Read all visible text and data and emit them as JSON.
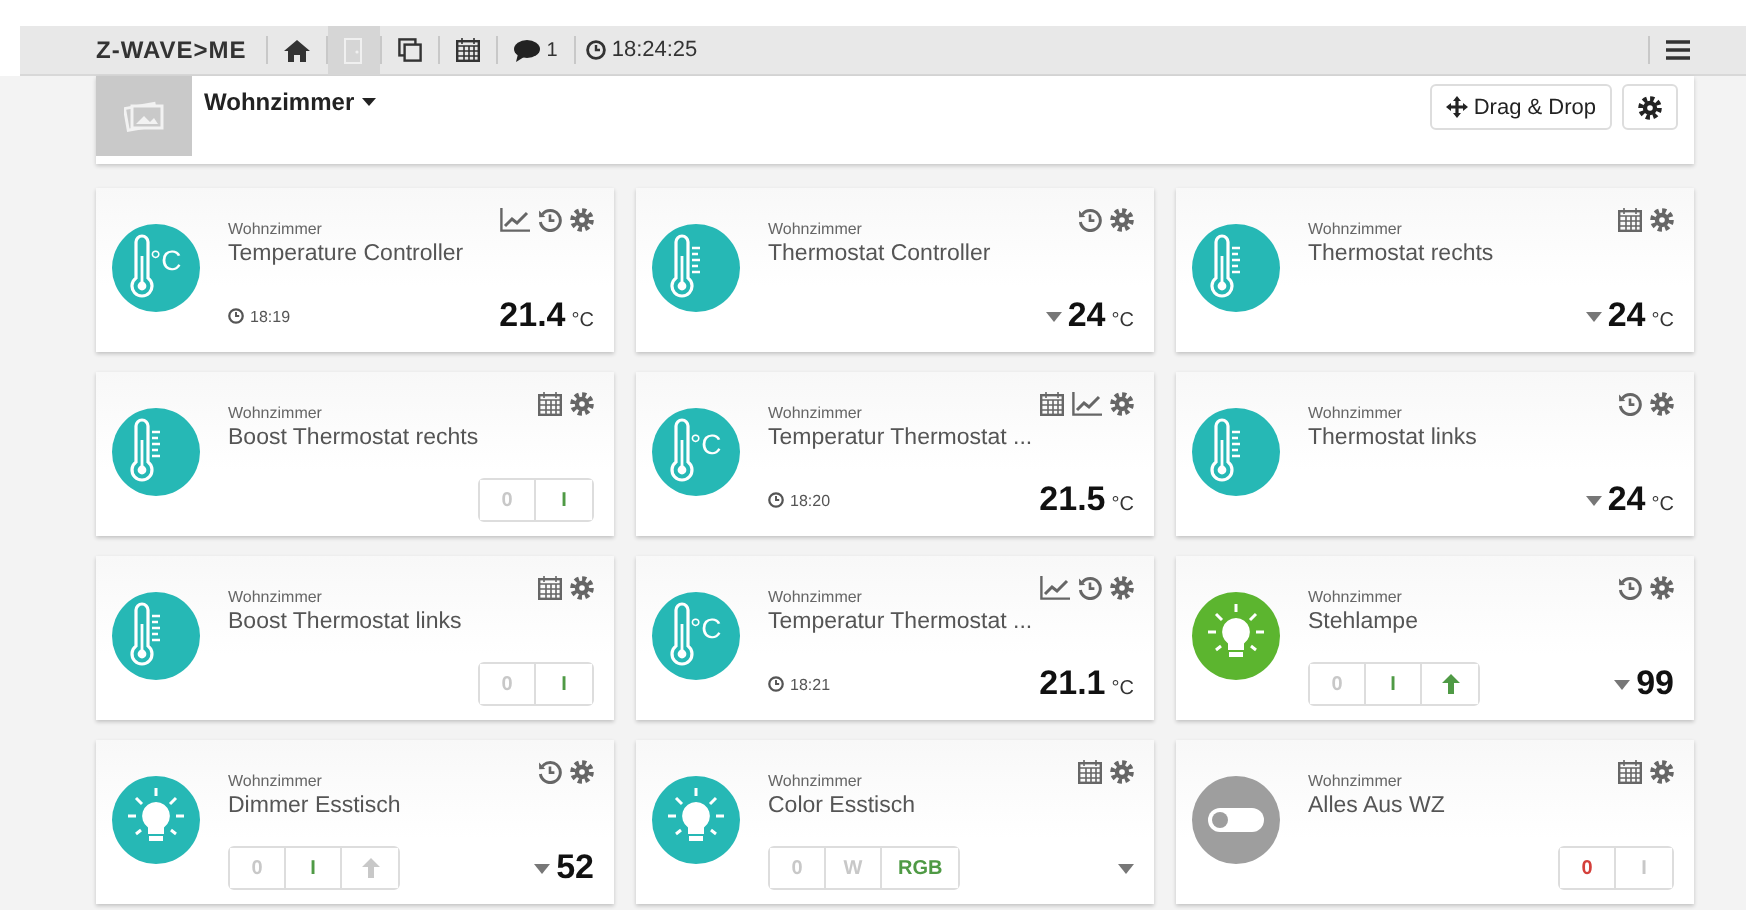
{
  "navbar": {
    "logo": "Z-WAVE>ME",
    "items": [
      {
        "kind": "home",
        "selected": false
      },
      {
        "kind": "room",
        "selected": true
      },
      {
        "kind": "elements",
        "selected": false
      },
      {
        "kind": "calendar",
        "selected": false
      },
      {
        "kind": "messages",
        "selected": false,
        "count": "1"
      }
    ],
    "clock": "18:24:25"
  },
  "room": {
    "name": "Wohnzimmer",
    "drag_button": "Drag & Drop"
  },
  "cards": [
    {
      "room": "Wohnzimmer",
      "name": "Temperature Controller",
      "symbol": {
        "kind": "thermometer",
        "label": "°C",
        "color": "#26b8b5"
      },
      "actions": [
        {
          "kind": "chart"
        },
        {
          "kind": "history"
        }
      ],
      "kind": "sensor",
      "time": "18:19",
      "value": "21.4",
      "unit": "°C"
    },
    {
      "room": "Wohnzimmer",
      "name": "Thermostat Controller",
      "symbol": {
        "kind": "thermometer",
        "color": "#26b8b5"
      },
      "actions": [
        {
          "kind": "history"
        }
      ],
      "kind": "thermostat",
      "value": "24",
      "unit": "°C"
    },
    {
      "room": "Wohnzimmer",
      "name": "Thermostat rechts",
      "symbol": {
        "kind": "thermometer",
        "color": "#26b8b5"
      },
      "actions": [
        {
          "kind": "calendar"
        }
      ],
      "kind": "thermostat",
      "value": "24",
      "unit": "°C"
    },
    {
      "room": "Wohnzimmer",
      "name": "Boost Thermostat rechts",
      "symbol": {
        "kind": "thermometer",
        "color": "#26b8b5"
      },
      "actions": [
        {
          "kind": "calendar"
        }
      ],
      "kind": "switch",
      "buttons": [
        {
          "kind": "off",
          "label": "0",
          "selected": false
        },
        {
          "kind": "on",
          "label": "I",
          "selected": true
        }
      ]
    },
    {
      "room": "Wohnzimmer",
      "name": "Temperatur Thermostat ...",
      "symbol": {
        "kind": "thermometer",
        "label": "°C",
        "color": "#26b8b5"
      },
      "actions": [
        {
          "kind": "calendar"
        },
        {
          "kind": "chart"
        }
      ],
      "kind": "sensor",
      "time": "18:20",
      "value": "21.5",
      "unit": "°C"
    },
    {
      "room": "Wohnzimmer",
      "name": "Thermostat links",
      "symbol": {
        "kind": "thermometer",
        "color": "#26b8b5"
      },
      "actions": [
        {
          "kind": "history"
        }
      ],
      "kind": "thermostat",
      "value": "24",
      "unit": "°C"
    },
    {
      "room": "Wohnzimmer",
      "name": "Boost Thermostat links",
      "symbol": {
        "kind": "thermometer",
        "color": "#26b8b5"
      },
      "actions": [
        {
          "kind": "calendar"
        }
      ],
      "kind": "switch",
      "buttons": [
        {
          "kind": "off",
          "label": "0",
          "selected": false
        },
        {
          "kind": "on",
          "label": "I",
          "selected": true
        }
      ]
    },
    {
      "room": "Wohnzimmer",
      "name": "Temperatur Thermostat ...",
      "symbol": {
        "kind": "thermometer",
        "label": "°C",
        "color": "#26b8b5"
      },
      "actions": [
        {
          "kind": "chart"
        },
        {
          "kind": "history"
        }
      ],
      "kind": "sensor",
      "time": "18:21",
      "value": "21.1",
      "unit": "°C"
    },
    {
      "room": "Wohnzimmer",
      "name": "Stehlampe",
      "symbol": {
        "kind": "bulb",
        "color": "#5cb52f"
      },
      "actions": [
        {
          "kind": "history"
        }
      ],
      "kind": "dimmer",
      "value": "99",
      "buttons": [
        {
          "kind": "off",
          "label": "0",
          "selected": false
        },
        {
          "kind": "on",
          "label": "I",
          "selected": true
        },
        {
          "kind": "up",
          "selected": true
        }
      ]
    },
    {
      "room": "Wohnzimmer",
      "name": "Dimmer Esstisch",
      "symbol": {
        "kind": "bulb",
        "color": "#26b8b5"
      },
      "actions": [
        {
          "kind": "history"
        }
      ],
      "kind": "dimmer",
      "value": "52",
      "buttons": [
        {
          "kind": "off",
          "label": "0",
          "selected": false
        },
        {
          "kind": "on",
          "label": "I",
          "selected": true
        },
        {
          "kind": "up",
          "selected": false
        }
      ]
    },
    {
      "room": "Wohnzimmer",
      "name": "Color Esstisch",
      "symbol": {
        "kind": "bulb",
        "color": "#26b8b5"
      },
      "actions": [
        {
          "kind": "calendar"
        }
      ],
      "kind": "rgb",
      "buttons": [
        {
          "kind": "off",
          "label": "0",
          "selected": false
        },
        {
          "kind": "white",
          "label": "W",
          "selected": false
        },
        {
          "kind": "rgb",
          "label": "RGB",
          "selected": true
        }
      ]
    },
    {
      "room": "Wohnzimmer",
      "name": "Alles Aus WZ",
      "symbol": {
        "kind": "toggle",
        "color": "#9e9e9e"
      },
      "actions": [
        {
          "kind": "calendar"
        }
      ],
      "kind": "switch",
      "buttons": [
        {
          "kind": "off",
          "label": "0",
          "selected": true
        },
        {
          "kind": "on",
          "label": "I",
          "selected": false
        }
      ]
    }
  ]
}
